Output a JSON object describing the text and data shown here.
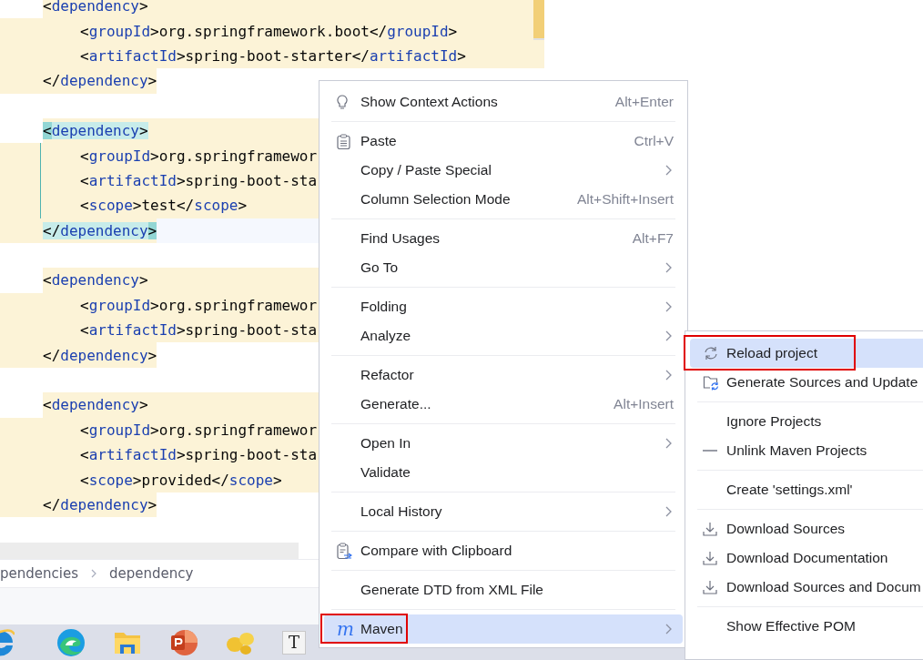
{
  "editor": {
    "blocks": [
      {
        "open": "<dependency>",
        "children": [
          "<groupId>org.springframework.boot</groupId>",
          "<artifactId>spring-boot-starter</artifactId>"
        ],
        "close": "</dependency>",
        "matched": false
      },
      {
        "open": "<dependency>",
        "children": [
          "<groupId>org.springframewor",
          "<artifactId>spring-boot-sta",
          "<scope>test</scope>"
        ],
        "close": "</dependency>",
        "matched": true
      },
      {
        "open": "<dependency>",
        "children": [
          "<groupId>org.springframewor",
          "<artifactId>spring-boot-sta"
        ],
        "close": "</dependency>",
        "matched": false
      },
      {
        "open": "<dependency>",
        "children": [
          "<groupId>org.springframewor",
          "<artifactId>spring-boot-sta",
          "<scope>provided</scope>"
        ],
        "close": "</dependency>",
        "matched": false
      }
    ]
  },
  "breadcrumb": {
    "items": [
      "pendencies",
      "dependency"
    ]
  },
  "taskbar": {
    "letter_app_icon": "T"
  },
  "context_menu": {
    "groups": [
      [
        {
          "kind": "bulb",
          "label": "Show Context Actions",
          "shortcut": "Alt+Enter",
          "submenu": false,
          "selected": false,
          "annotated": false
        }
      ],
      [
        {
          "kind": "clipboard",
          "label": "Paste",
          "shortcut": "Ctrl+V",
          "submenu": false,
          "selected": false,
          "annotated": false
        },
        {
          "kind": "plain",
          "label": "Copy / Paste Special",
          "submenu": true,
          "selected": false,
          "annotated": false
        },
        {
          "kind": "plain",
          "label": "Column Selection Mode",
          "shortcut": "Alt+Shift+Insert",
          "submenu": false,
          "selected": false,
          "annotated": false
        }
      ],
      [
        {
          "kind": "plain",
          "label": "Find Usages",
          "shortcut": "Alt+F7",
          "submenu": false,
          "selected": false,
          "annotated": false
        },
        {
          "kind": "plain",
          "label": "Go To",
          "submenu": true,
          "selected": false,
          "annotated": false
        }
      ],
      [
        {
          "kind": "plain",
          "label": "Folding",
          "submenu": true,
          "selected": false,
          "annotated": false
        },
        {
          "kind": "plain",
          "label": "Analyze",
          "submenu": true,
          "selected": false,
          "annotated": false
        }
      ],
      [
        {
          "kind": "plain",
          "label": "Refactor",
          "submenu": true,
          "selected": false,
          "annotated": false
        },
        {
          "kind": "plain",
          "label": "Generate...",
          "shortcut": "Alt+Insert",
          "submenu": false,
          "selected": false,
          "annotated": false
        }
      ],
      [
        {
          "kind": "plain",
          "label": "Open In",
          "submenu": true,
          "selected": false,
          "annotated": false
        },
        {
          "kind": "plain",
          "label": "Validate",
          "submenu": false,
          "selected": false,
          "annotated": false
        }
      ],
      [
        {
          "kind": "plain",
          "label": "Local History",
          "submenu": true,
          "selected": false,
          "annotated": false
        }
      ],
      [
        {
          "kind": "compare",
          "label": "Compare with Clipboard",
          "submenu": false,
          "selected": false,
          "annotated": false
        }
      ],
      [
        {
          "kind": "plain",
          "label": "Generate DTD from XML File",
          "submenu": false,
          "selected": false,
          "annotated": false
        }
      ],
      [
        {
          "kind": "letter",
          "icon": "m",
          "label": "Maven",
          "submenu": true,
          "selected": true,
          "annotated": true
        }
      ]
    ]
  },
  "submenu": {
    "groups": [
      [
        {
          "kind": "reload",
          "label": "Reload project",
          "selected": true,
          "annotated": true
        },
        {
          "kind": "folder-sync",
          "label": "Generate Sources and Update",
          "selected": false,
          "annotated": false
        }
      ],
      [
        {
          "kind": "plain",
          "label": "Ignore Projects",
          "selected": false,
          "annotated": false
        },
        {
          "kind": "dash",
          "label": "Unlink Maven Projects",
          "selected": false,
          "annotated": false
        }
      ],
      [
        {
          "kind": "plain",
          "label": "Create 'settings.xml'",
          "selected": false,
          "annotated": false
        }
      ],
      [
        {
          "kind": "download",
          "label": "Download Sources",
          "selected": false,
          "annotated": false
        },
        {
          "kind": "download",
          "label": "Download Documentation",
          "selected": false,
          "annotated": false
        },
        {
          "kind": "download",
          "label": "Download Sources and Docum",
          "selected": false,
          "annotated": false
        }
      ],
      [
        {
          "kind": "plain",
          "label": "Show Effective POM",
          "selected": false,
          "annotated": false
        }
      ]
    ]
  }
}
